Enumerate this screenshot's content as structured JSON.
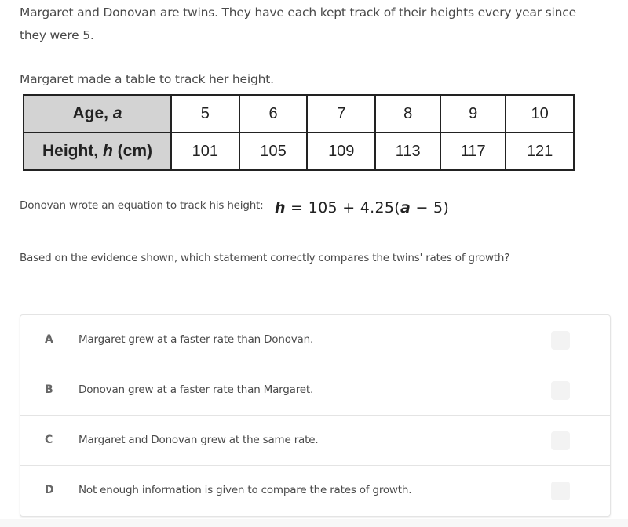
{
  "intro": {
    "line1": "Margaret and Donovan are twins. They have each kept track of their heights every year since they were 5.",
    "line2": "Margaret made a table to track her height."
  },
  "table": {
    "row_headers": [
      {
        "label": "Age, ",
        "var": "a",
        "suffix": ""
      },
      {
        "label": "Height, ",
        "var": "h",
        "suffix": " (cm)"
      }
    ],
    "ages": [
      "5",
      "6",
      "7",
      "8",
      "9",
      "10"
    ],
    "heights": [
      "101",
      "105",
      "109",
      "113",
      "117",
      "121"
    ]
  },
  "donovan": {
    "text": "Donovan wrote an equation to track his height:",
    "equation": {
      "lhs": "h",
      "eq": " = 105 + 4.25(",
      "var": "a",
      "rest": " − 5)"
    }
  },
  "question": "Based on the evidence shown, which statement correctly compares the twins' rates of growth?",
  "choices": [
    {
      "letter": "A",
      "text": "Margaret grew at a faster rate than Donovan."
    },
    {
      "letter": "B",
      "text": "Donovan grew at a faster rate than Margaret."
    },
    {
      "letter": "C",
      "text": "Margaret and Donovan grew at the same rate."
    },
    {
      "letter": "D",
      "text": "Not enough information is given to compare the rates of growth."
    }
  ]
}
